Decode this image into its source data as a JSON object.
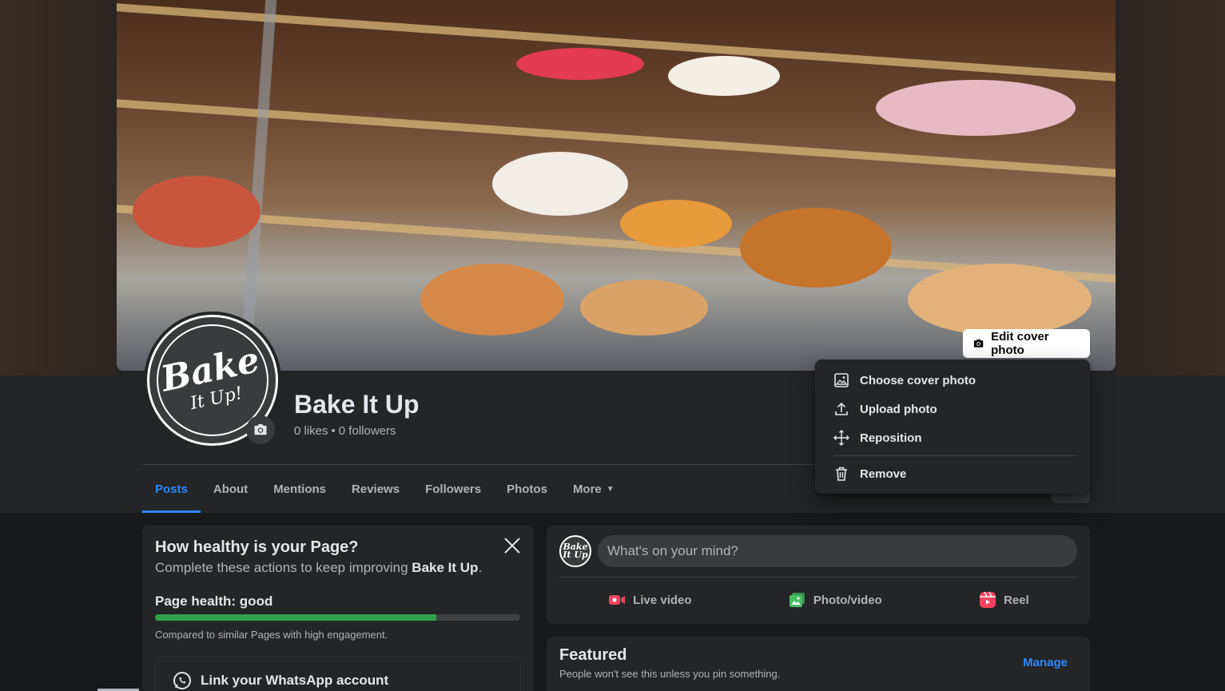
{
  "page": {
    "name": "Bake It Up",
    "likes": "0 likes",
    "separator": "•",
    "followers": "0 followers"
  },
  "avatar_logo": {
    "line1": "Bake",
    "line2": "It Up!"
  },
  "mini_avatar_logo": "Bake It Up",
  "cover": {
    "edit_label": "Edit cover photo"
  },
  "cover_menu": {
    "items": [
      {
        "label": "Choose cover photo",
        "icon": "image-frame-icon"
      },
      {
        "label": "Upload photo",
        "icon": "upload-icon"
      },
      {
        "label": "Reposition",
        "icon": "move-arrows-icon"
      },
      {
        "label": "Remove",
        "icon": "trash-icon"
      }
    ]
  },
  "tabs": [
    {
      "label": "Posts",
      "active": true
    },
    {
      "label": "About"
    },
    {
      "label": "Mentions"
    },
    {
      "label": "Reviews"
    },
    {
      "label": "Followers"
    },
    {
      "label": "Photos"
    },
    {
      "label": "More"
    }
  ],
  "health": {
    "title": "How healthy is your Page?",
    "subtitle_prefix": "Complete these actions to keep improving ",
    "subtitle_name": "Bake It Up",
    "subtitle_suffix": ".",
    "status": "Page health: good",
    "progress": 0.77,
    "note": "Compared to similar Pages with high engagement.",
    "whatsapp_label": "Link your WhatsApp account"
  },
  "composer": {
    "placeholder": "What's on your mind?",
    "actions": [
      {
        "label": "Live video",
        "icon": "live-video-icon",
        "color": "#f3425f"
      },
      {
        "label": "Photo/video",
        "icon": "photo-icon",
        "color": "#45bd62"
      },
      {
        "label": "Reel",
        "icon": "reel-icon",
        "color": "#f3425f"
      }
    ]
  },
  "featured": {
    "title": "Featured",
    "subtitle": "People won't see this unless you pin something.",
    "manage_label": "Manage"
  },
  "colors": {
    "accent": "#2d88ff",
    "health_good": "#31a24c",
    "background": "#18191a",
    "surface": "#242526"
  }
}
